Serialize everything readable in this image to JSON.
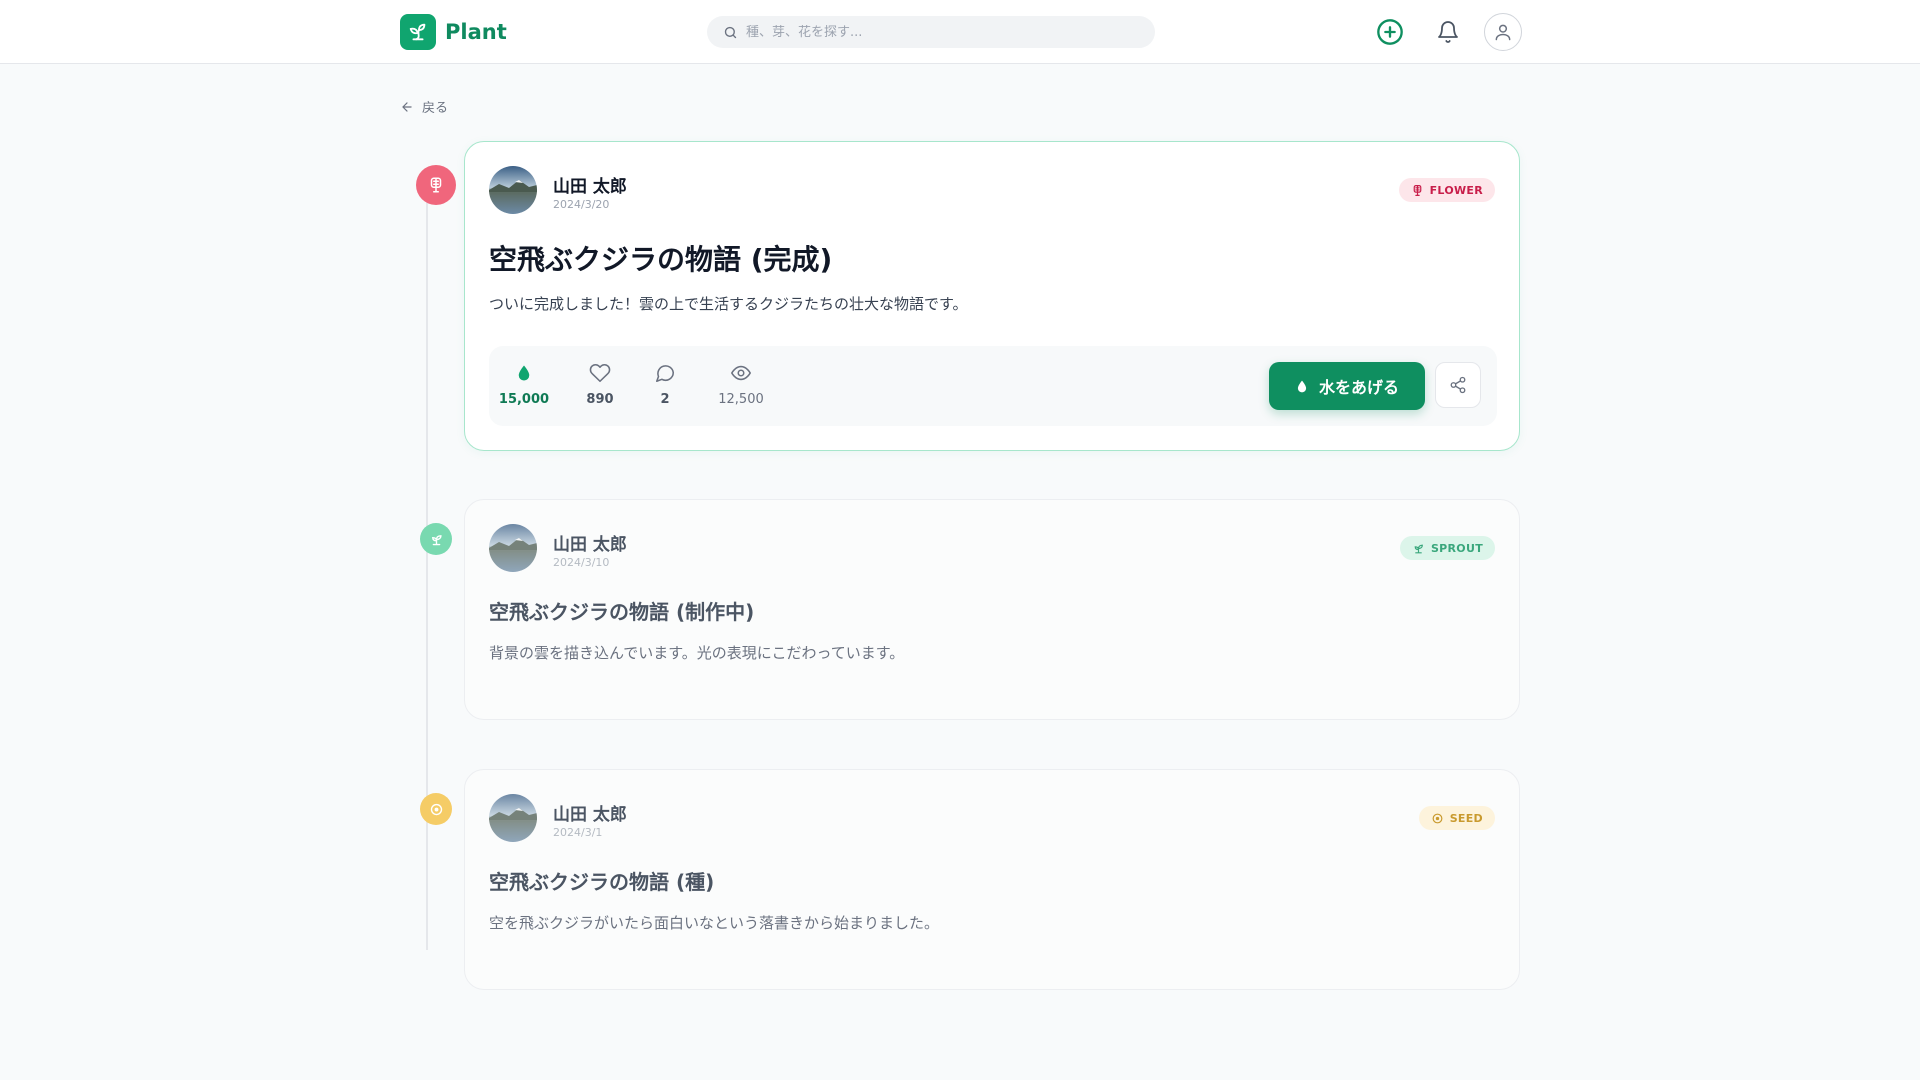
{
  "app": {
    "name": "Plant"
  },
  "search": {
    "placeholder": "種、芽、花を探す..."
  },
  "nav": {
    "back_label": "戻る"
  },
  "colors": {
    "brand": "#10a56f",
    "brand_dark": "#0f8f60",
    "flower": "#f0667c",
    "sprout": "#79d9b0",
    "seed": "#f5cc66"
  },
  "posts": [
    {
      "author": "山田 太郎",
      "date": "2024/3/20",
      "stage": "FLOWER",
      "stage_icon": "flower-icon",
      "title": "空飛ぶクジラの物語 (完成)",
      "description": "ついに完成しました！雲の上で生活するクジラたちの壮大な物語です。",
      "stats": {
        "water": "15,000",
        "likes": "890",
        "comments": "2",
        "views": "12,500"
      },
      "water_button": "水をあげる"
    },
    {
      "author": "山田 太郎",
      "date": "2024/3/10",
      "stage": "SPROUT",
      "stage_icon": "sprout-icon",
      "title": "空飛ぶクジラの物語 (制作中)",
      "description": "背景の雲を描き込んでいます。光の表現にこだわっています。"
    },
    {
      "author": "山田 太郎",
      "date": "2024/3/1",
      "stage": "SEED",
      "stage_icon": "seed-icon",
      "title": "空飛ぶクジラの物語 (種)",
      "description": "空を飛ぶクジラがいたら面白いなという落書きから始まりました。"
    }
  ]
}
